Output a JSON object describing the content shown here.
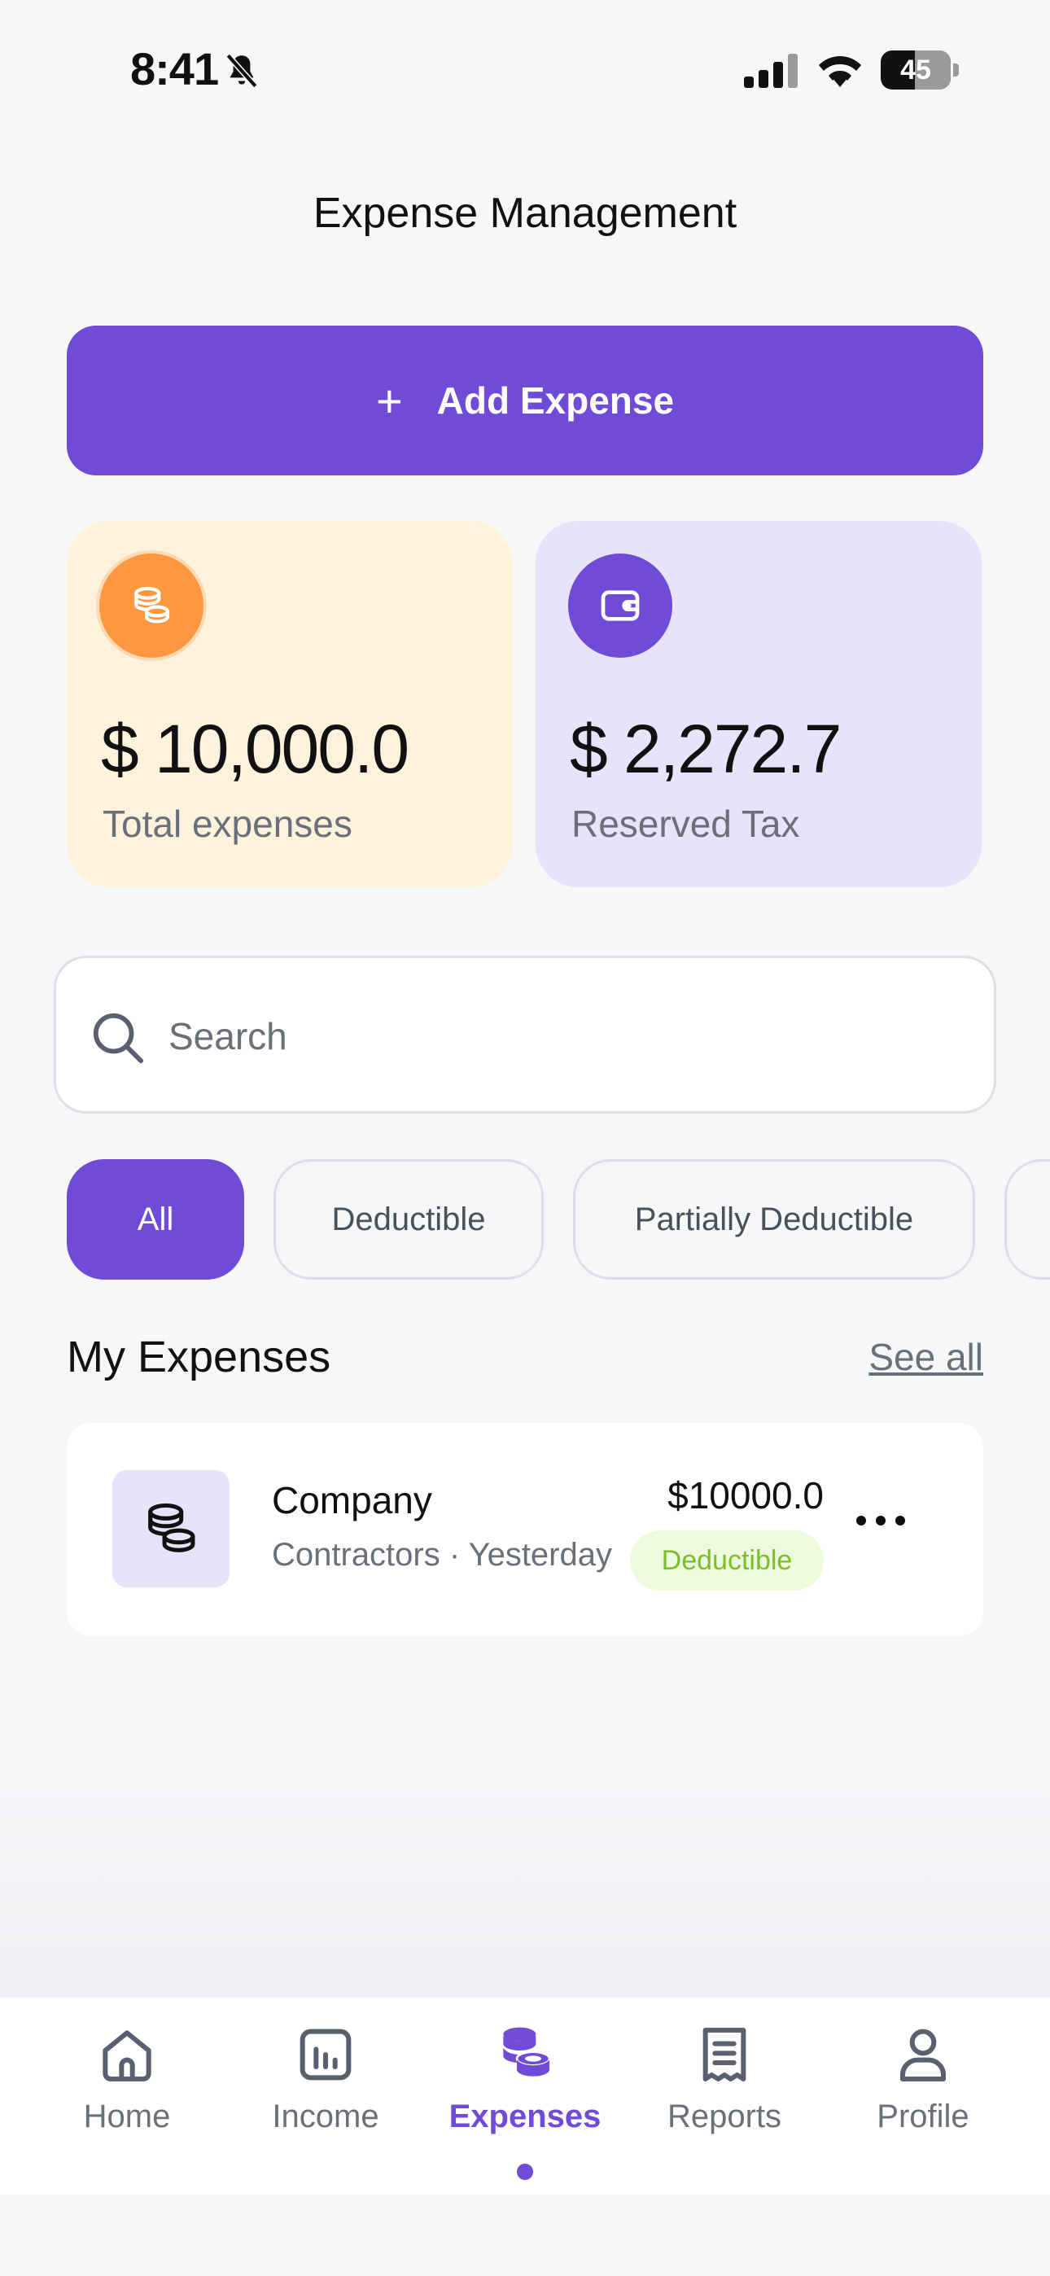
{
  "status_bar": {
    "time": "8:41",
    "battery": "45"
  },
  "header": {
    "title": "Expense Management"
  },
  "actions": {
    "add_expense_label": "Add Expense"
  },
  "summary": {
    "total_expenses": {
      "amount": "$ 10,000.0",
      "label": "Total expenses"
    },
    "reserved_tax": {
      "amount": "$ 2,272.7",
      "label": "Reserved Tax"
    }
  },
  "search": {
    "placeholder": "Search"
  },
  "filters": [
    {
      "label": "All",
      "active": true
    },
    {
      "label": "Deductible",
      "active": false
    },
    {
      "label": "Partially Deductible",
      "active": false
    }
  ],
  "expenses_section": {
    "title": "My Expenses",
    "see_all": "See all"
  },
  "expenses": [
    {
      "title": "Company",
      "subtitle": "Contractors · Yesterday",
      "amount": "$10000.0",
      "badge": "Deductible"
    }
  ],
  "tabbar": [
    {
      "label": "Home",
      "icon": "home-icon"
    },
    {
      "label": "Income",
      "icon": "chart-icon"
    },
    {
      "label": "Expenses",
      "icon": "coins-icon",
      "active": true
    },
    {
      "label": "Reports",
      "icon": "receipt-icon"
    },
    {
      "label": "Profile",
      "icon": "user-icon"
    }
  ],
  "colors": {
    "accent": "#6f4bd8",
    "orange": "#ff9640",
    "badge_green": "#7cbd2c"
  }
}
